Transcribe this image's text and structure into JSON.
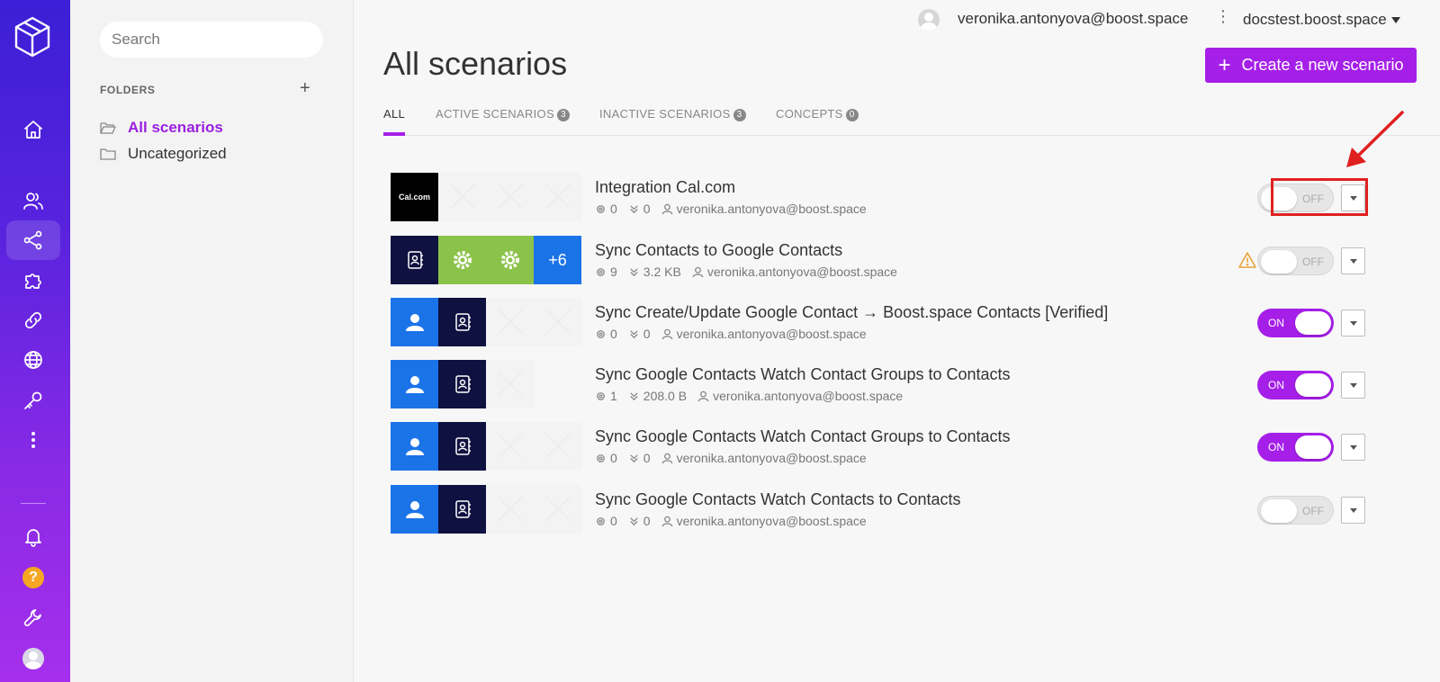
{
  "nav": {
    "items": [
      "home-icon",
      "team-icon",
      "scenarios-icon",
      "templates-icon",
      "connections-icon",
      "webhooks-icon",
      "keys-icon",
      "more-icon",
      "notifications-icon",
      "help-icon",
      "settings-icon",
      "profile-icon"
    ],
    "active": "scenarios-icon",
    "help_label": "?",
    "accent_top": "#3b1fd6",
    "accent_bottom": "#a52fec"
  },
  "sidebar": {
    "search_placeholder": "Search",
    "folders_heading": "FOLDERS",
    "add_label": "+",
    "folders": [
      {
        "label": "All scenarios",
        "active": true
      },
      {
        "label": "Uncategorized",
        "active": false
      }
    ]
  },
  "topbar": {
    "user_email": "veronika.antonyova@boost.space",
    "kebab": "⋮",
    "org": "docstest.boost.space"
  },
  "page": {
    "title": "All scenarios",
    "create_button": "Create a new scenario",
    "create_plus": "+",
    "accent": "#a51fe8"
  },
  "tabs": [
    {
      "label": "ALL",
      "count": null,
      "active": true
    },
    {
      "label": "ACTIVE SCENARIOS",
      "count": "3",
      "active": false
    },
    {
      "label": "INACTIVE SCENARIOS",
      "count": "3",
      "active": false
    },
    {
      "label": "CONCEPTS",
      "count": "0",
      "active": false
    }
  ],
  "scenarios": [
    {
      "name": "Integration Cal.com",
      "ops": "0",
      "transfer": "0",
      "owner": "veronika.antonyova@boost.space",
      "status": "OFF",
      "trigger": "instant",
      "warning": false,
      "thumbs_text": "Cal.com"
    },
    {
      "name": "Sync Contacts to Google Contacts",
      "ops": "9",
      "transfer": "3.2 KB",
      "owner": "veronika.antonyova@boost.space",
      "status": "OFF",
      "trigger": "scheduled",
      "warning": true,
      "more_modules": "+6"
    },
    {
      "name": "Sync Create/Update Google Contact → Boost.space Contacts [Verified]",
      "ops": "0",
      "transfer": "0",
      "owner": "veronika.antonyova@boost.space",
      "status": "ON",
      "trigger": "scheduled",
      "warning": false
    },
    {
      "name": "Sync Google Contacts Watch Contact Groups to Contacts",
      "ops": "1",
      "transfer": "208.0 B",
      "owner": "veronika.antonyova@boost.space",
      "status": "ON",
      "trigger": "scheduled",
      "warning": false
    },
    {
      "name": "Sync Google Contacts Watch Contact Groups to Contacts",
      "ops": "0",
      "transfer": "0",
      "owner": "veronika.antonyova@boost.space",
      "status": "ON",
      "trigger": "scheduled",
      "warning": false
    },
    {
      "name": "Sync Google Contacts Watch Contacts to Contacts",
      "ops": "0",
      "transfer": "0",
      "owner": "veronika.antonyova@boost.space",
      "status": "OFF",
      "trigger": "scheduled",
      "warning": false
    }
  ],
  "annotation": {
    "color": "#e02020"
  }
}
